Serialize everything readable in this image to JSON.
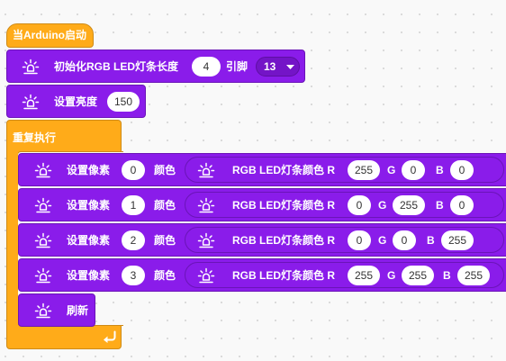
{
  "hat": {
    "label": "当Arduino启动"
  },
  "init_block": {
    "label": "初始化RGB LED灯条长度",
    "length": "4",
    "pin_label": "引脚",
    "pin_value": "13"
  },
  "brightness_block": {
    "label": "设置亮度",
    "value": "150"
  },
  "loop_block": {
    "label": "重复执行"
  },
  "pixel_rows": [
    {
      "set_label": "设置像素",
      "index": "0",
      "color_label": "颜色",
      "rgb_label": "RGB LED灯条颜色 R",
      "r": "255",
      "g_label": "G",
      "g": "0",
      "b_label": "B",
      "b": "0"
    },
    {
      "set_label": "设置像素",
      "index": "1",
      "color_label": "颜色",
      "rgb_label": "RGB LED灯条颜色 R",
      "r": "0",
      "g_label": "G",
      "g": "255",
      "b_label": "B",
      "b": "0"
    },
    {
      "set_label": "设置像素",
      "index": "2",
      "color_label": "颜色",
      "rgb_label": "RGB LED灯条颜色 R",
      "r": "0",
      "g_label": "G",
      "g": "0",
      "b_label": "B",
      "b": "255"
    },
    {
      "set_label": "设置像素",
      "index": "3",
      "color_label": "颜色",
      "rgb_label": "RGB LED灯条颜色 R",
      "r": "255",
      "g_label": "G",
      "g": "255",
      "b_label": "B",
      "b": "255"
    }
  ],
  "refresh_block": {
    "label": "刷新"
  },
  "icons": {
    "block_icon": "light-bulb-icon",
    "dropdown": "triangle-down-icon",
    "loop_end": "loop-arrow-icon"
  },
  "colors": {
    "event_orange": "#FFAB19",
    "led_purple": "#8A1CEA",
    "background": "#F9F9F9"
  }
}
